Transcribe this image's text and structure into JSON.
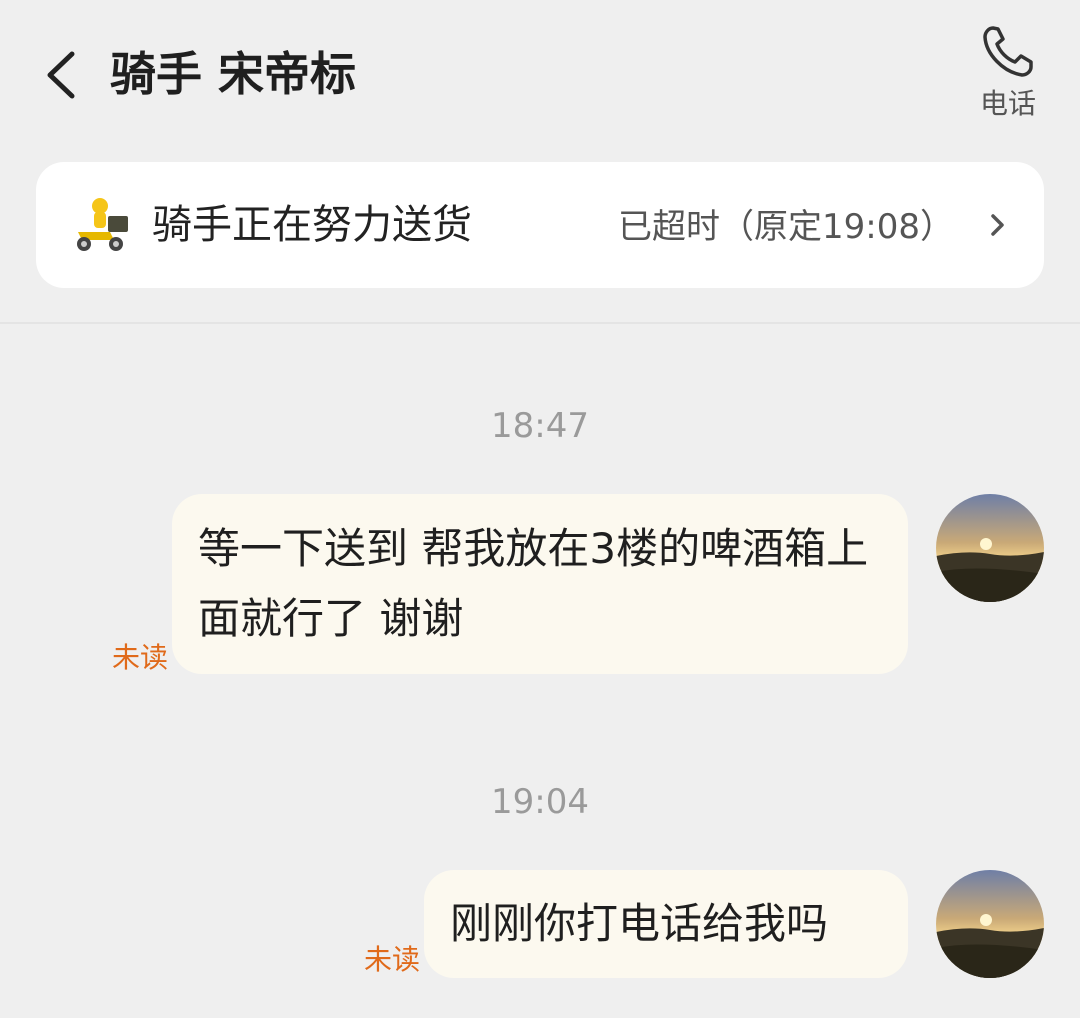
{
  "header": {
    "title": "骑手 宋帝标",
    "call_label": "电话"
  },
  "status_card": {
    "text": "骑手正在努力送货",
    "overtime": "已超时（原定19:08）"
  },
  "messages": [
    {
      "time": "18:47",
      "text": "等一下送到 帮我放在3楼的啤酒箱上面就行了 谢谢",
      "status": "未读"
    },
    {
      "time": "19:04",
      "text": "刚刚你打电话给我吗",
      "status": "未读"
    }
  ],
  "icons": {
    "back": "chevron-left-icon",
    "phone": "phone-icon",
    "rider": "delivery-scooter-icon",
    "more": "chevron-right-icon"
  },
  "colors": {
    "background": "#efefef",
    "bubble": "#fcf9ef",
    "unread": "#e06a1a",
    "time": "#9a9a9a"
  }
}
